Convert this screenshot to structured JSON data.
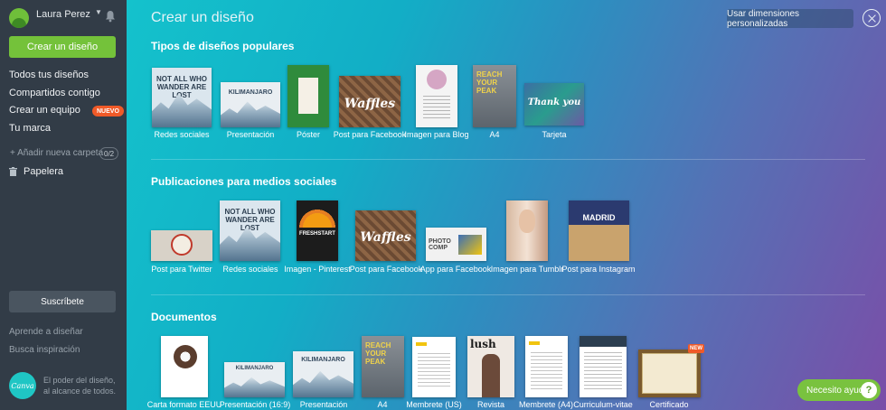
{
  "sidebar": {
    "user_name": "Laura Perez",
    "create_label": "Crear un diseño",
    "nav": [
      "Todos tus diseños",
      "Compartidos contigo",
      "Crear un equipo",
      "Tu marca"
    ],
    "new_badge": "NUEVO",
    "add_folder": "+ Añadir nueva carpeta",
    "folder_count": "0/2",
    "trash": "Papelera",
    "subscribe": "Suscríbete",
    "learn": "Aprende a diseñar",
    "inspiration": "Busca inspiración",
    "tagline": "El poder del diseño, al alcance de todos.",
    "logo_text": "Canva"
  },
  "main": {
    "title": "Crear un diseño",
    "custom_dims": "Usar dimensiones personalizadas",
    "sections": [
      {
        "title": "Tipos de diseños populares",
        "items": [
          "Redes sociales",
          "Presentación",
          "Póster",
          "Post para Facebook",
          "Imagen para Blog",
          "A4",
          "Tarjeta"
        ]
      },
      {
        "title": "Publicaciones para medios sociales",
        "items": [
          "Post para Twitter",
          "Redes sociales",
          "Imagen - Pinterest",
          "Post para Facebook",
          "App para Facebook",
          "Imagen para Tumblr",
          "Post para Instagram"
        ]
      },
      {
        "title": "Documentos",
        "items": [
          "Carta formato EEUU",
          "Presentación (16:9)",
          "Presentación",
          "A4",
          "Membrete (US)",
          "Revista",
          "Membrete (A4)",
          "Curriculum-vitae",
          "Certificado"
        ]
      }
    ],
    "thumb_text": {
      "wander": "NOT ALL WHO WANDER ARE LOST",
      "kilimanjaro": "KILIMANJARO",
      "waffles": "Waffles",
      "reach": "REACH YOUR PEAK",
      "thank": "Thank you",
      "photo": "PHOTO COMP",
      "madrid": "MADRID",
      "lush": "lush",
      "fresh": "FRESHSTART"
    },
    "new_label": "NEW",
    "help": "Necesito ayuda",
    "help_q": "?"
  },
  "colors": {
    "sidebar_bg": "#323c47",
    "accent_green": "#74c23a",
    "badge_orange": "#f05a28",
    "gradient_start": "#14c2cc",
    "gradient_end": "#7a4ea8"
  }
}
